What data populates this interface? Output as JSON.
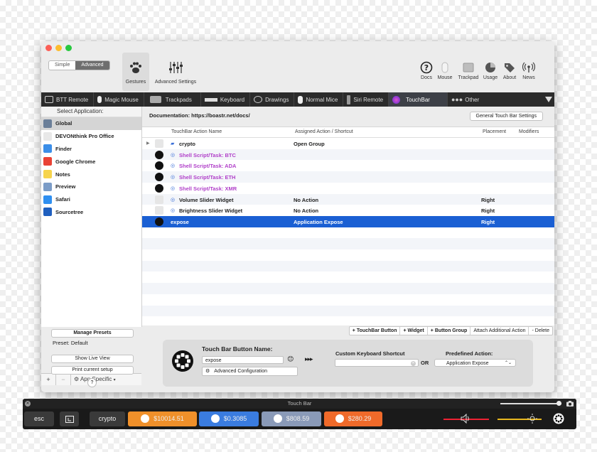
{
  "window": {
    "mode_segment": [
      "Simple",
      "Advanced"
    ],
    "mode_selected": "Advanced",
    "toolbar_left": [
      {
        "label": "Gestures",
        "icon": "paw-icon",
        "selected": true
      },
      {
        "label": "Advanced Settings",
        "icon": "sliders-icon",
        "selected": false
      }
    ],
    "toolbar_right": [
      {
        "label": "Docs",
        "icon": "question-icon"
      },
      {
        "label": "Mouse",
        "icon": "mouse-icon"
      },
      {
        "label": "Trackpad",
        "icon": "trackpad-icon"
      },
      {
        "label": "Usage",
        "icon": "pie-icon"
      },
      {
        "label": "About",
        "icon": "tags-icon"
      },
      {
        "label": "News",
        "icon": "broadcast-icon"
      }
    ]
  },
  "tabs": [
    {
      "label": "BTT Remote",
      "icon": "remote-icon"
    },
    {
      "label": "Magic Mouse",
      "icon": "mouse-icon"
    },
    {
      "label": "Trackpads",
      "icon": "trackpad-icon"
    },
    {
      "label": "Keyboard",
      "icon": "keyboard-icon"
    },
    {
      "label": "Drawings",
      "icon": "spiral-icon"
    },
    {
      "label": "Normal Mice",
      "icon": "mouse-icon"
    },
    {
      "label": "Siri Remote",
      "icon": "remote-icon"
    },
    {
      "label": "TouchBar",
      "icon": "siri-icon",
      "selected": true
    },
    {
      "label": "Other",
      "icon": "dots-icon"
    }
  ],
  "sidebar": {
    "header": "Select Application:",
    "apps": [
      {
        "label": "Global",
        "color": "#6b7f99",
        "selected": true
      },
      {
        "label": "DEVONthink Pro Office",
        "color": "#e8e8e8"
      },
      {
        "label": "Finder",
        "color": "#3b8ee8"
      },
      {
        "label": "Google Chrome",
        "color": "#e94235"
      },
      {
        "label": "Notes",
        "color": "#f6d44c"
      },
      {
        "label": "Preview",
        "color": "#7b9cc7"
      },
      {
        "label": "Safari",
        "color": "#2f8ff0"
      },
      {
        "label": "Sourcetree",
        "color": "#1f5fbf"
      }
    ],
    "add": "+",
    "remove": "−",
    "app_specific": "App Specific",
    "manage_presets": "Manage Presets",
    "preset": "Preset: Default",
    "show_live_view": "Show Live View",
    "print_setup": "Print current setup",
    "help": "?"
  },
  "main": {
    "documentation": "Documentation: https://boastr.net/docs/",
    "general_settings": "General Touch Bar Settings",
    "columns": [
      "TouchBar Action Name",
      "Assigned Action / Shortcut",
      "Placement",
      "Modifiers"
    ],
    "rows": [
      {
        "name": "crypto",
        "action": "Open Group",
        "placement": "",
        "style": "bold",
        "icon": "folder-icon"
      },
      {
        "name": "Shell Script/Task: BTC",
        "action": "",
        "placement": "",
        "style": "purple",
        "icon": "bitcoin-icon"
      },
      {
        "name": "Shell Script/Task: ADA",
        "action": "",
        "placement": "",
        "style": "purple",
        "icon": "cardano-icon"
      },
      {
        "name": "Shell Script/Task: ETH",
        "action": "",
        "placement": "",
        "style": "purple",
        "icon": "ethereum-icon"
      },
      {
        "name": "Shell Script/Task: XMR",
        "action": "",
        "placement": "",
        "style": "purple",
        "icon": "monero-icon"
      },
      {
        "name": "Volume Slider Widget",
        "action": "No Action",
        "placement": "Right",
        "style": "bold",
        "icon": "slider-icon"
      },
      {
        "name": "Brightness Slider Widget",
        "action": "No Action",
        "placement": "Right",
        "style": "bold",
        "icon": "slider-icon"
      },
      {
        "name": "expose",
        "action": "Application Expose",
        "placement": "Right",
        "style": "selected",
        "icon": "expose-icon"
      }
    ],
    "actions": [
      "+ TouchBar Button",
      "+ Widget",
      "+ Button Group",
      "Attach Additional Action",
      "- Delete"
    ],
    "editor": {
      "name_label": "Touch Bar Button Name:",
      "name_value": "expose",
      "emoji": "😊",
      "arrows": "▸▸▸",
      "advanced": "Advanced Configuration",
      "shortcut_label": "Custom Keyboard Shortcut",
      "or": "OR",
      "predefined_label": "Predefined Action:",
      "predefined_value": "Application Expose"
    }
  },
  "touchbar": {
    "title": "Touch Bar",
    "esc": "esc",
    "group": "crypto",
    "coins": [
      {
        "value": "$10014.51",
        "color": "#f0902a",
        "icon": "bitcoin-icon"
      },
      {
        "value": "$0.3085",
        "color": "#3a7ce0",
        "icon": "cardano-icon"
      },
      {
        "value": "$808.59",
        "color": "#8a9ab8",
        "icon": "ethereum-icon"
      },
      {
        "value": "$280.29",
        "color": "#f06a2a",
        "icon": "monero-icon"
      }
    ]
  }
}
